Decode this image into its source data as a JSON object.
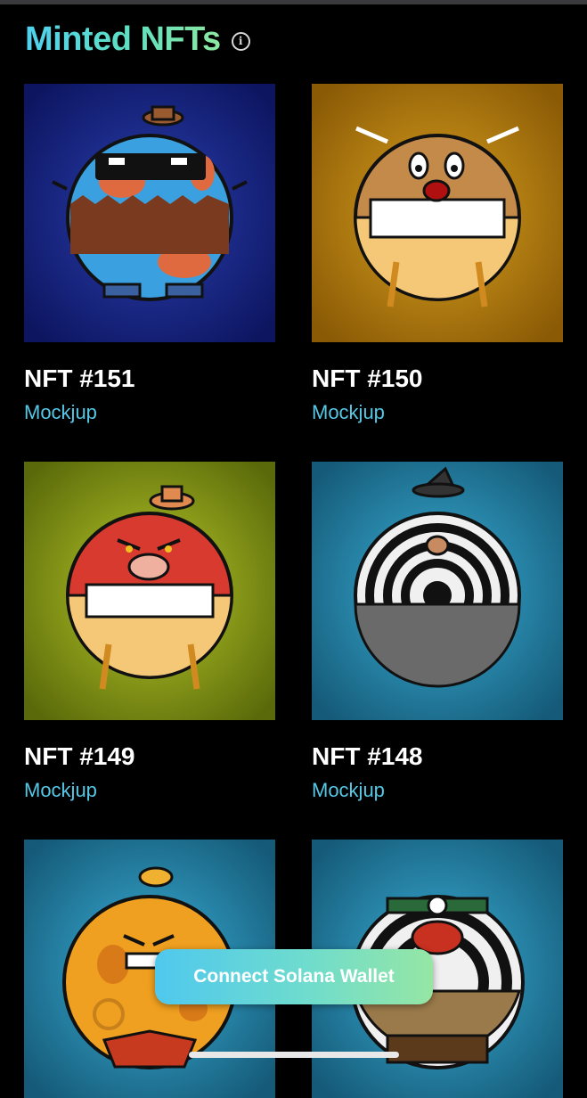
{
  "header": {
    "title": "Minted NFTs",
    "info_icon": "info-icon"
  },
  "nfts": [
    {
      "name": "NFT #151",
      "collection": "Mockjup",
      "bg": [
        "#1a2a8a",
        "#0d1560"
      ],
      "body": "#3aa0e0",
      "accent": "#e06a40"
    },
    {
      "name": "NFT #150",
      "collection": "Mockjup",
      "bg": [
        "#c08a10",
        "#8a5a05"
      ],
      "body": "#c48a4a",
      "accent": "#f5c878"
    },
    {
      "name": "NFT #149",
      "collection": "Mockjup",
      "bg": [
        "#9aa818",
        "#5a6a0a"
      ],
      "body": "#d83a30",
      "accent": "#f5c878"
    },
    {
      "name": "NFT #148",
      "collection": "Mockjup",
      "bg": [
        "#2a9ac0",
        "#155a78"
      ],
      "body": "#f0f0f0",
      "accent": "#555555"
    },
    {
      "name": "",
      "collection": "",
      "bg": [
        "#2a9ac0",
        "#155a78"
      ],
      "body": "#f0a020",
      "accent": "#c83a20"
    },
    {
      "name": "",
      "collection": "",
      "bg": [
        "#2a9ac0",
        "#155a78"
      ],
      "body": "#f0f0f0",
      "accent": "#8a6a40"
    }
  ],
  "footer": {
    "connect_label": "Connect Solana Wallet"
  }
}
